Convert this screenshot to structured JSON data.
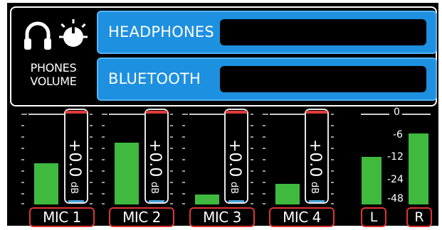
{
  "phones_volume": {
    "label_line1": "PHONES",
    "label_line2": "VOLUME",
    "rows": [
      {
        "label": "HEADPHONES"
      },
      {
        "label": "BLUETOOTH"
      }
    ]
  },
  "channels": [
    {
      "label": "MIC 1",
      "gain": "+0.0",
      "unit": "dB",
      "level": 0.45
    },
    {
      "label": "MIC 2",
      "gain": "+0.0",
      "unit": "dB",
      "level": 0.68
    },
    {
      "label": "MIC 3",
      "gain": "+0.0",
      "unit": "dB",
      "level": 0.11
    },
    {
      "label": "MIC 4",
      "gain": "+0.0",
      "unit": "dB",
      "level": 0.23
    }
  ],
  "master": {
    "scale": [
      "0",
      "-6",
      "-12",
      "-24",
      "-48"
    ],
    "left_label": "L",
    "right_label": "R",
    "left_level": 0.52,
    "right_level": 0.78
  },
  "colors": {
    "row_bg": "#1e90e0",
    "meter": "#3fba3f",
    "label_border": "#e03434",
    "fader_top": "#e23b3b",
    "fader_bottom": "#4aa8e6"
  }
}
